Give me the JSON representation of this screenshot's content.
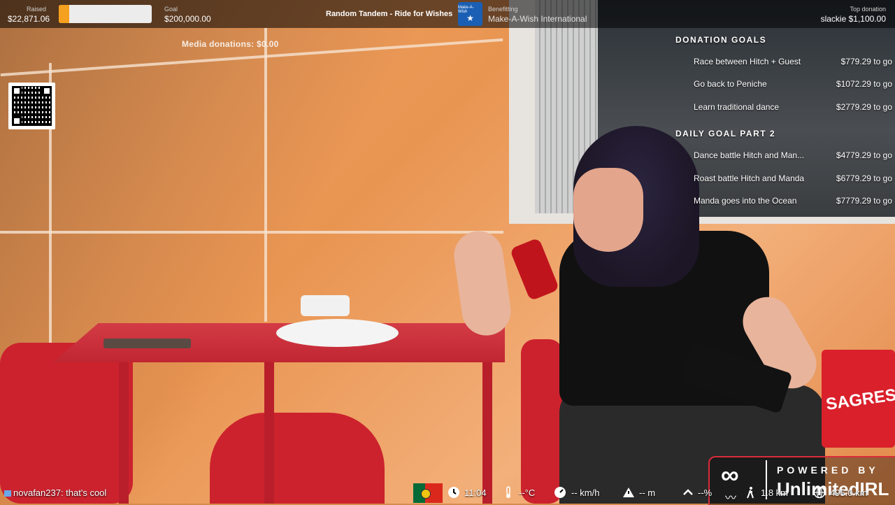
{
  "topbar": {
    "raised_label": "Raised",
    "raised_value": "$22,871.06",
    "raised_progress": 0.114,
    "goal_label": "Goal",
    "goal_value": "$200,000.00",
    "stream_title": "Random Tandem - Ride for Wishes",
    "benefitting_label": "Benefitting",
    "benefitting_value": "Make-A-Wish International",
    "charity_logo_text": "Make-A-Wish",
    "top_donation_label": "Top donation",
    "top_donation_value": "slackie $1,100.00"
  },
  "media_donations": "Media donations: $0.00",
  "goals": {
    "donation_heading": "DONATION GOALS",
    "donation_goals": [
      {
        "name": "Race between Hitch + Guest",
        "amount": "$779.29 to go"
      },
      {
        "name": "Go back to Peniche",
        "amount": "$1072.29 to go"
      },
      {
        "name": "Learn traditional dance",
        "amount": "$2779.29 to go"
      }
    ],
    "daily_heading": "DAILY GOAL PART 2",
    "daily_goals": [
      {
        "name": "Dance battle Hitch and Man...",
        "amount": "$4779.29 to go"
      },
      {
        "name": "Roast battle Hitch and Manda",
        "amount": "$6779.29 to go"
      },
      {
        "name": "Manda goes into the Ocean",
        "amount": "$7779.29 to go"
      }
    ]
  },
  "chat": {
    "message": "novafan237: that's cool"
  },
  "status": {
    "time": "11:04",
    "temperature": "--°C",
    "speed": "-- km/h",
    "altitude": "-- m",
    "incline": "--%",
    "distance": "1.8 km",
    "total_distance": "495.0 km"
  },
  "icons": {
    "clock": "clock-icon",
    "thermometer": "thermometer-icon",
    "speedometer": "speedometer-icon",
    "mountain": "mountain-icon",
    "incline": "incline-icon",
    "walker": "walker-icon",
    "globe": "globe-icon",
    "flag": "portugal-flag-icon"
  },
  "powered": {
    "label": "POWERED BY",
    "brand": "UnlimitedIRL"
  },
  "scene": {
    "sign_text": "SAGRES"
  },
  "colors": {
    "accent_progress": "#f5a01e",
    "brand_red": "#d92b3a",
    "charity_blue": "#1a5fb4"
  }
}
